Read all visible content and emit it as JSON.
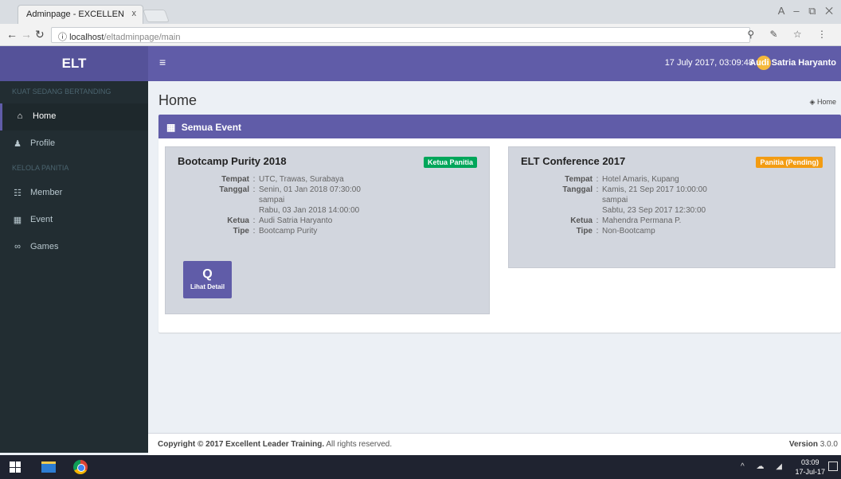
{
  "browser": {
    "tab_title": "Adminpage - EXCELLEN",
    "tab_close": "x",
    "window_controls": "A – ⧉ ✕",
    "url_host": "localhost",
    "url_path": "/eltadminpage/main",
    "info_icon": "ⓘ",
    "icons": "⚲ ✎ ☆ ⋮"
  },
  "app": {
    "logo": "ELT",
    "datetime": "17 July 2017, 03:09:48",
    "username": "Audi Satria Haryanto"
  },
  "sidebar": {
    "header_1": "Kuat Sedang Bertanding",
    "header_2": "Kelola Panitia",
    "items": [
      {
        "label": "Home",
        "icon": "⌂"
      },
      {
        "label": "Profile",
        "icon": "♟"
      },
      {
        "label": "Member",
        "icon": "☷"
      },
      {
        "label": "Event",
        "icon": "▦"
      },
      {
        "label": "Games",
        "icon": "∞"
      }
    ]
  },
  "page": {
    "title": "Home",
    "breadcrumb": "Home"
  },
  "box": {
    "title": "Semua Event",
    "icon": "▦"
  },
  "events": [
    {
      "title": "Bootcamp Purity 2018",
      "badge": "Ketua Panitia",
      "badge_color": "#00a65a",
      "tempat_label": "Tempat",
      "tempat": "UTC, Trawas, Surabaya",
      "tanggal_label": "Tanggal",
      "tanggal_start": "Senin, 01 Jan 2018 07:30:00",
      "sampai": "sampai",
      "tanggal_end": "Rabu, 03 Jan 2018 14:00:00",
      "ketua_label": "Ketua",
      "ketua": "Audi Satria Haryanto",
      "tipe_label": "Tipe",
      "tipe": "Bootcamp Purity",
      "detail_button": "Lihat Detail",
      "detail_icon": "Q"
    },
    {
      "title": "ELT Conference 2017",
      "badge": "Panitia (Pending)",
      "badge_color": "#f39c12",
      "tempat_label": "Tempat",
      "tempat": "Hotel Amaris, Kupang",
      "tanggal_label": "Tanggal",
      "tanggal_start": "Kamis, 21 Sep 2017 10:00:00",
      "sampai": "sampai",
      "tanggal_end": "Sabtu, 23 Sep 2017 12:30:00",
      "ketua_label": "Ketua",
      "ketua": "Mahendra Permana P.",
      "tipe_label": "Tipe",
      "tipe": "Non-Bootcamp"
    }
  ],
  "footer": {
    "copyright": "Copyright © 2017 Excellent Leader Training.",
    "rights": "All rights reserved.",
    "version_label": "Version",
    "version": "3.0.0"
  },
  "taskbar": {
    "tray": "^ ☁ ◢",
    "time": "03:09",
    "date": "17-Jul-17"
  },
  "colors": {
    "primary": "#605ca8",
    "sidebar_bg": "#222d32",
    "success": "#00a65a",
    "warning": "#f39c12"
  }
}
